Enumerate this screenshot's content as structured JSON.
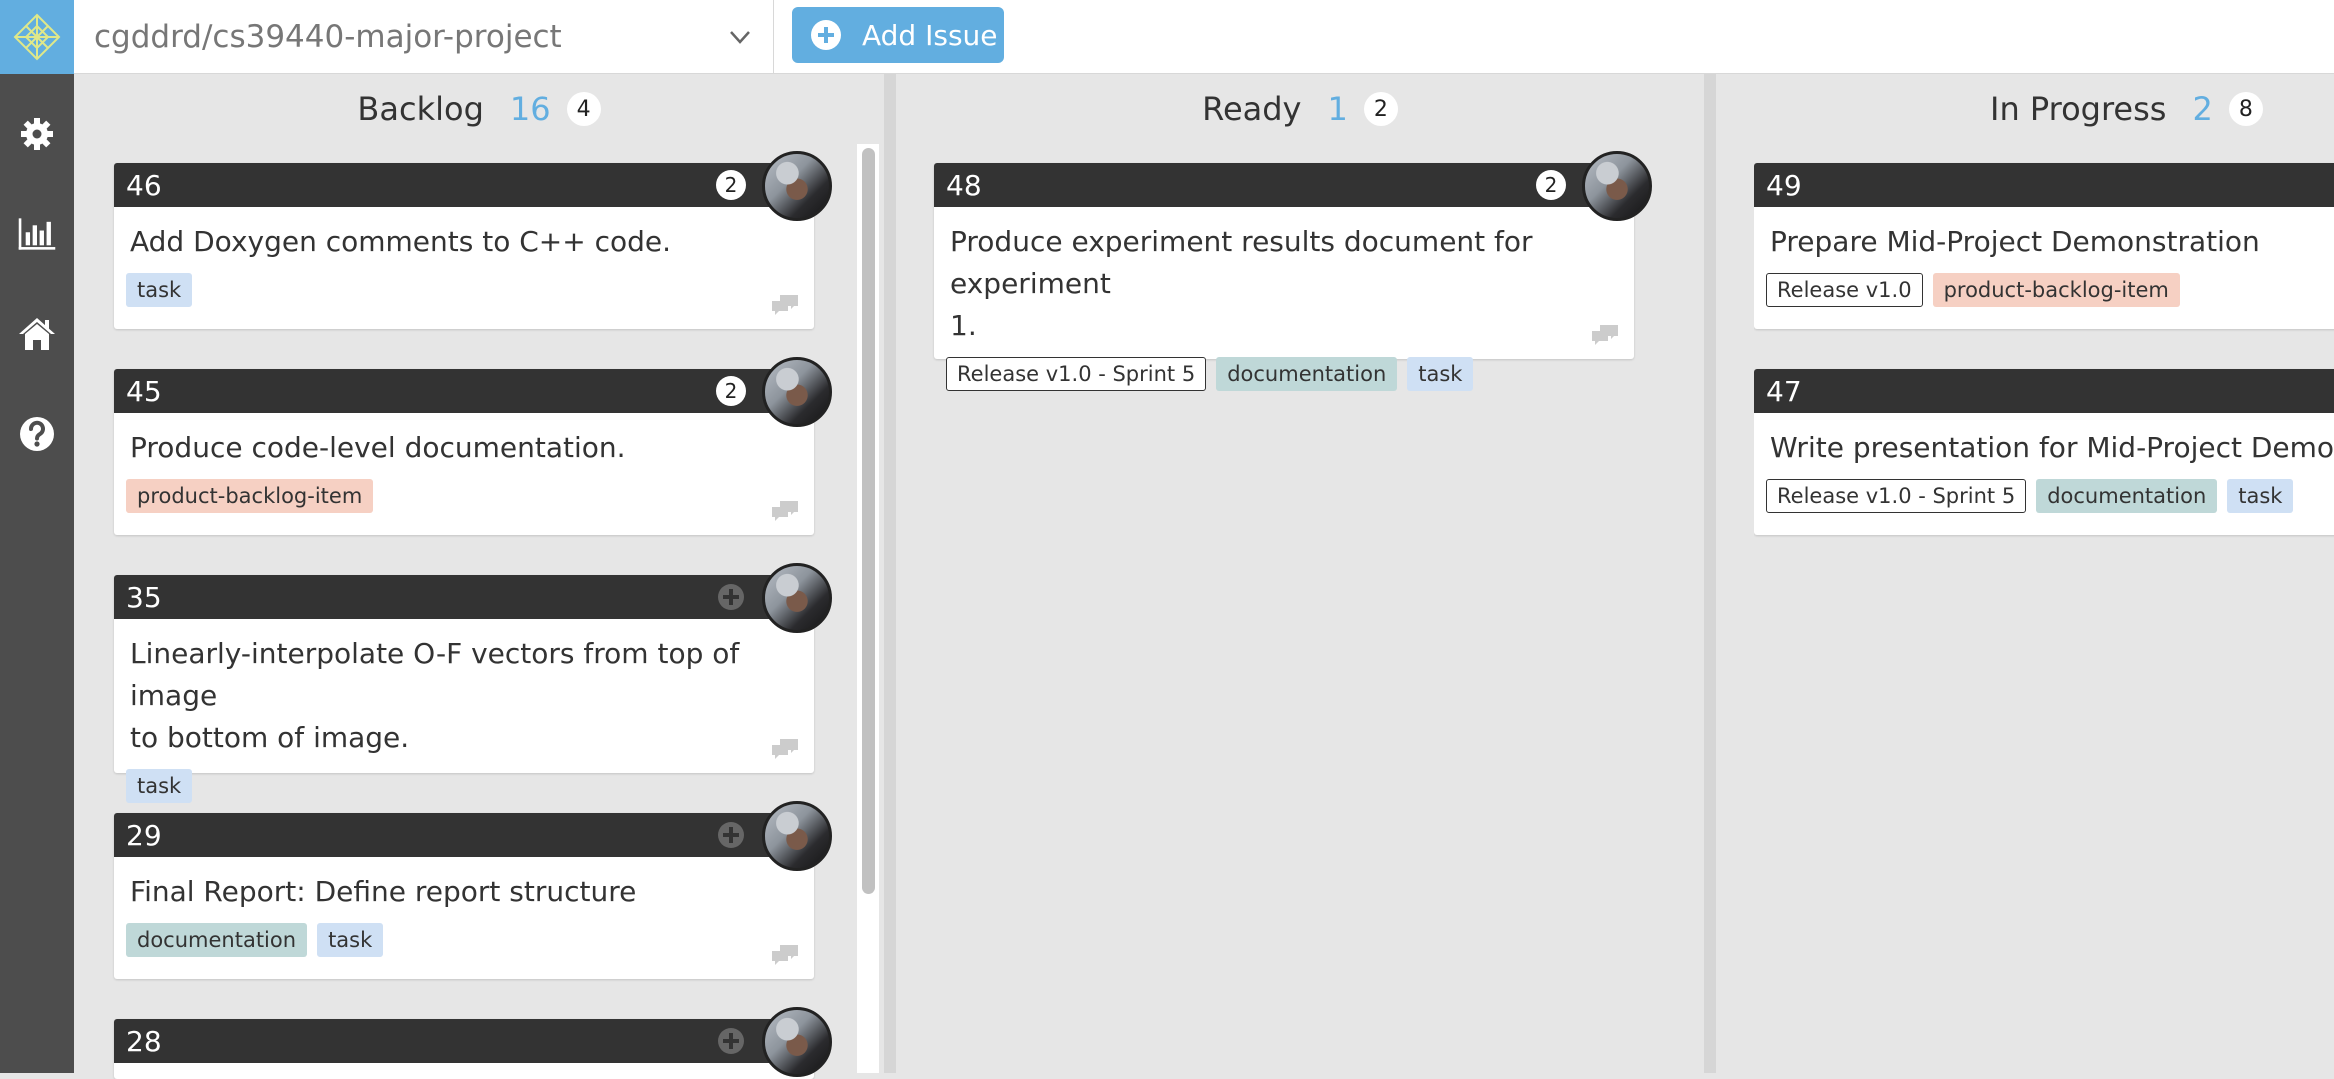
{
  "header": {
    "repo_name": "cgddrd/cs39440-major-project",
    "add_issue_label": "Add Issue"
  },
  "sidebar": {
    "items": [
      {
        "icon": "gear-icon"
      },
      {
        "icon": "bar-chart-icon"
      },
      {
        "icon": "home-icon"
      },
      {
        "icon": "help-icon"
      }
    ]
  },
  "columns": [
    {
      "title": "Backlog",
      "count": "16",
      "badge": "4",
      "cards": [
        {
          "number": "46",
          "badge": "2",
          "title": "Add Doxygen comments to C++ code.",
          "tags": [
            "task"
          ]
        },
        {
          "number": "45",
          "badge": "2",
          "title": "Produce code-level documentation.",
          "tags": [
            "product-backlog-item"
          ]
        },
        {
          "number": "35",
          "badge": "",
          "title_line1": "Linearly-interpolate O-F vectors from top of image",
          "title_line2": "to bottom of image.",
          "tags": [
            "task"
          ]
        },
        {
          "number": "29",
          "badge": "",
          "title": "Final Report: Define report structure",
          "tags": [
            "documentation",
            "task"
          ]
        },
        {
          "number": "28",
          "badge": ""
        }
      ]
    },
    {
      "title": "Ready",
      "count": "1",
      "badge": "2",
      "cards": [
        {
          "number": "48",
          "badge": "2",
          "title_line1": "Produce experiment results document for experiment",
          "title_line2": "1.",
          "tags": [
            "Release v1.0 - Sprint 5",
            "documentation",
            "task"
          ]
        }
      ]
    },
    {
      "title": "In Progress",
      "count": "2",
      "badge": "8",
      "cards": [
        {
          "number": "49",
          "title": "Prepare Mid-Project Demonstration",
          "tags": [
            "Release v1.0",
            "product-backlog-item"
          ]
        },
        {
          "number": "47",
          "title": "Write presentation for Mid-Project Demo.",
          "tags": [
            "Release v1.0 - Sprint 5",
            "documentation",
            "task"
          ]
        }
      ]
    }
  ],
  "colors": {
    "accent": "#62aee0",
    "sidebar": "#4d4d4d",
    "card_header": "#333333",
    "tag_task": "#cfe0f4",
    "tag_documentation": "#bfd8d8",
    "tag_product_backlog_item": "#f6d0c3"
  }
}
